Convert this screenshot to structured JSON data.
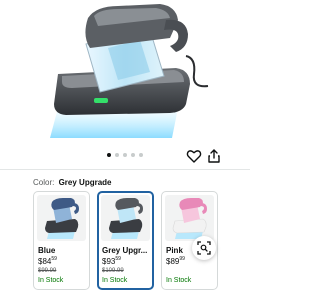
{
  "product": {
    "image_alt": "UV bed vacuum cleaner product image",
    "carousel": {
      "total": 5,
      "active_index": 0
    }
  },
  "actions": {
    "favorite_icon": "heart-icon",
    "share_icon": "share-icon"
  },
  "color_selector": {
    "label": "Color:",
    "selected": "Grey Upgrade"
  },
  "variants": [
    {
      "name": "Blue",
      "price_whole": "$84",
      "price_fraction": "59",
      "list_price": "$99.99",
      "availability": "In Stock",
      "body_color": "#3e5a86",
      "accent_color": "#8fb3d8"
    },
    {
      "name": "Grey Upgr...",
      "price_whole": "$93",
      "price_fraction": "59",
      "list_price": "$109.99",
      "availability": "In Stock",
      "body_color": "#55595e",
      "accent_color": "#9aa0a6",
      "selected": true
    },
    {
      "name": "Pink",
      "price_whole": "$89",
      "price_fraction": "99",
      "list_price": "",
      "availability": "In Stock",
      "body_color": "#e889b8",
      "accent_color": "#f6c6dd"
    }
  ],
  "colors": {
    "selected_border": "#2162a1",
    "in_stock": "#007600",
    "uv_glow": "#9fe3ff"
  },
  "lens_icon": "camera-search-icon"
}
